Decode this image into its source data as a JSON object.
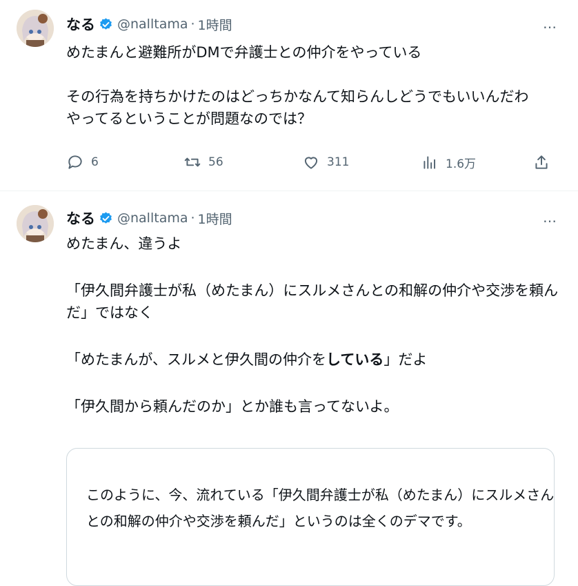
{
  "tweets": [
    {
      "author": {
        "name": "なる",
        "handle": "@nalltama",
        "time": "1時間",
        "verified": true
      },
      "more_label": "…",
      "body": [
        "めたまんと避難所がDMで弁護士との仲介をやっている",
        "",
        "その行為を持ちかけたのはどっちかなんて知らんしどうでもいいんだわ",
        "やってるということが問題なのでは？"
      ],
      "actions": {
        "replies": "6",
        "retweets": "56",
        "likes": "311",
        "views": "1.6万"
      }
    },
    {
      "author": {
        "name": "なる",
        "handle": "@nalltama",
        "time": "1時間",
        "verified": true
      },
      "more_label": "…",
      "body": {
        "line1": "めたまん、違うよ",
        "line2": "「伊久間弁護士が私（めたまん）にスルメさんとの和解の仲介や交渉を頼ん",
        "line3": "だ」ではなく",
        "line4_pre": "「めたまんが、スルメと伊久間の仲介を",
        "line4_bold": "している",
        "line4_post": "」だよ",
        "line5": "「伊久間から頼んだのか」とか誰も言ってないよ。"
      },
      "quote": {
        "line1": "このように、今、流れている「伊久間弁護士が私（めたまん）にスルメさん",
        "line2": "との和解の仲介や交渉を頼んだ」というのは全くのデマです。"
      }
    }
  ],
  "icons": {
    "verified": "verified-badge-icon",
    "reply": "reply-icon",
    "retweet": "retweet-icon",
    "like": "heart-icon",
    "views": "views-chart-icon",
    "share": "share-icon",
    "more": "more-dots-icon"
  },
  "colors": {
    "verified": "#1d9bf0",
    "muted": "#536471",
    "text": "#0f1419",
    "border": "#cfd9de"
  }
}
